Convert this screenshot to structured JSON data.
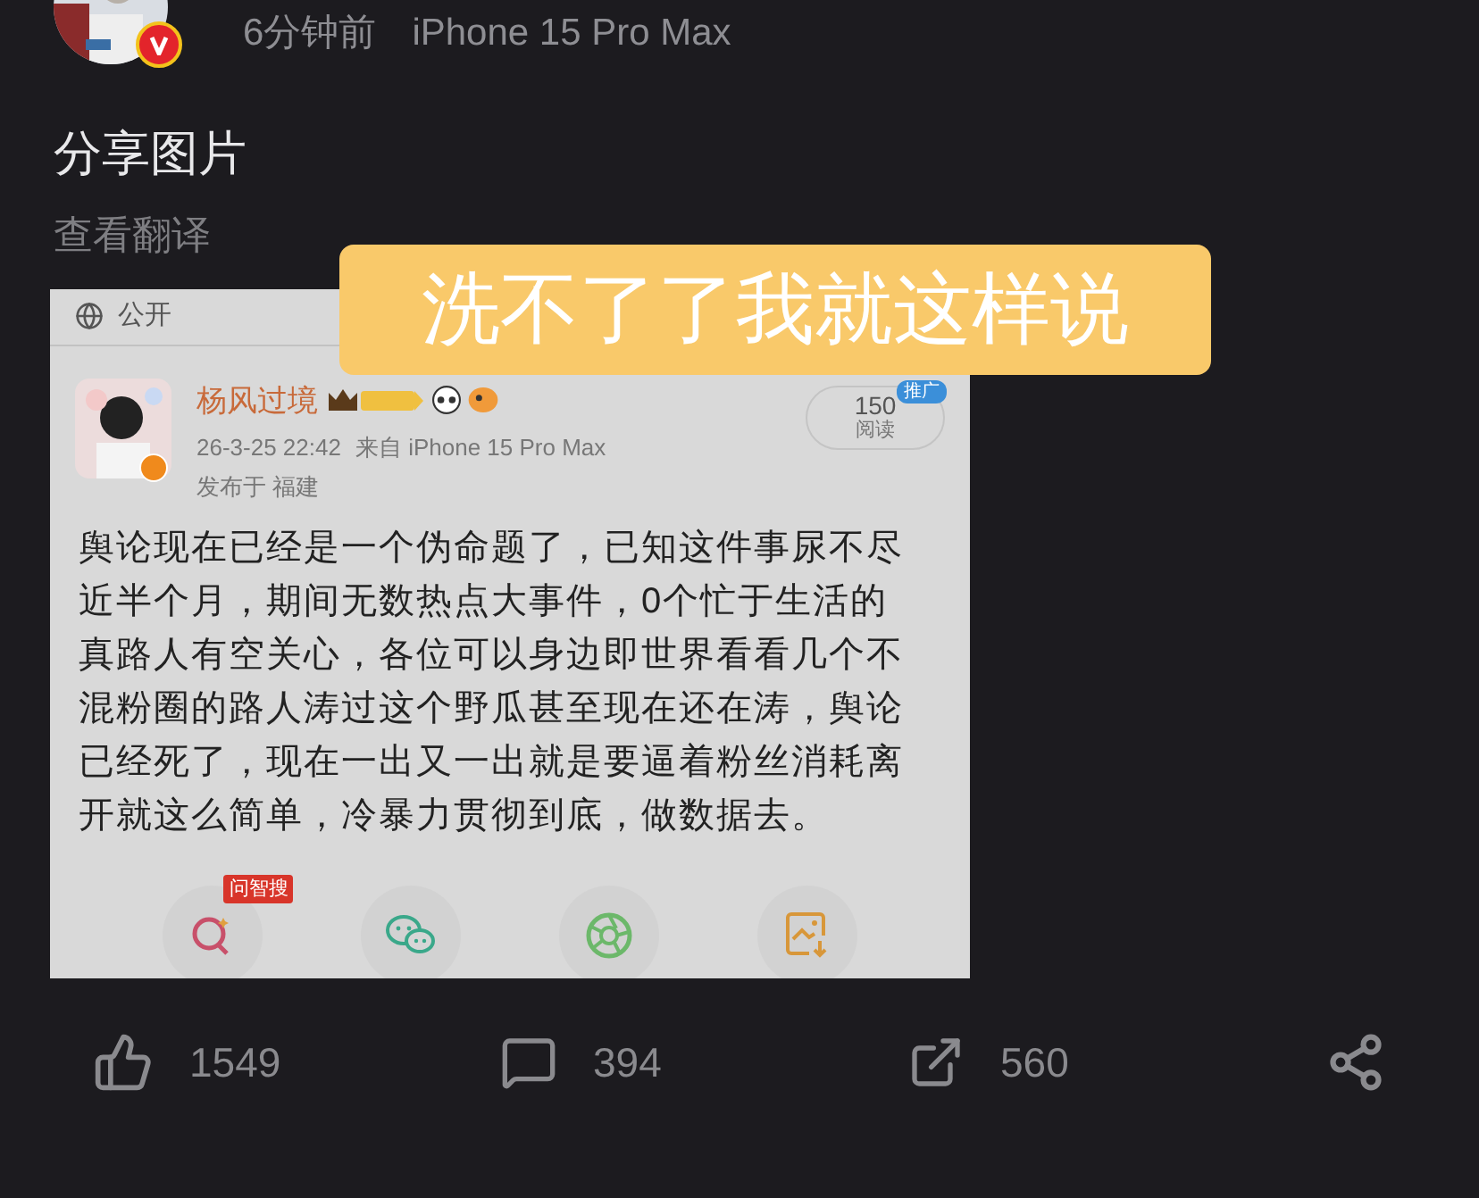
{
  "post": {
    "meta_time": "6分钟前",
    "meta_device": "iPhone 15 Pro Max",
    "verified": true,
    "text": "分享图片",
    "translate_link": "查看翻译"
  },
  "caption_overlay": "洗不了了我就这样说",
  "embedded_screenshot": {
    "visibility": "公开",
    "author": "杨风过境",
    "time": "26-3-25 22:42",
    "source": "来自 iPhone 15 Pro Max",
    "location": "发布于 福建",
    "reads": "150",
    "reads_label": "阅读",
    "promo_tag": "推广",
    "body": "舆论现在已经是一个伪命题了，已知这件事尿不尽近半个月，期间无数热点大事件，0个忙于生活的真路人有空关心，各位可以身边即世界看看几个不混粉圈的路人涛过这个野瓜甚至现在还在涛，舆论已经死了，现在一出又一出就是要逼着粉丝消耗离开就这么简单，冷暴力贯彻到底，做数据去。",
    "share_targets": [
      {
        "kind": "search",
        "badge": "问智搜"
      },
      {
        "kind": "wechat"
      },
      {
        "kind": "moments"
      },
      {
        "kind": "save"
      }
    ]
  },
  "actions": [
    {
      "kind": "like",
      "count": "1549"
    },
    {
      "kind": "comment",
      "count": "394"
    },
    {
      "kind": "forward",
      "count": "560"
    },
    {
      "kind": "share"
    }
  ]
}
